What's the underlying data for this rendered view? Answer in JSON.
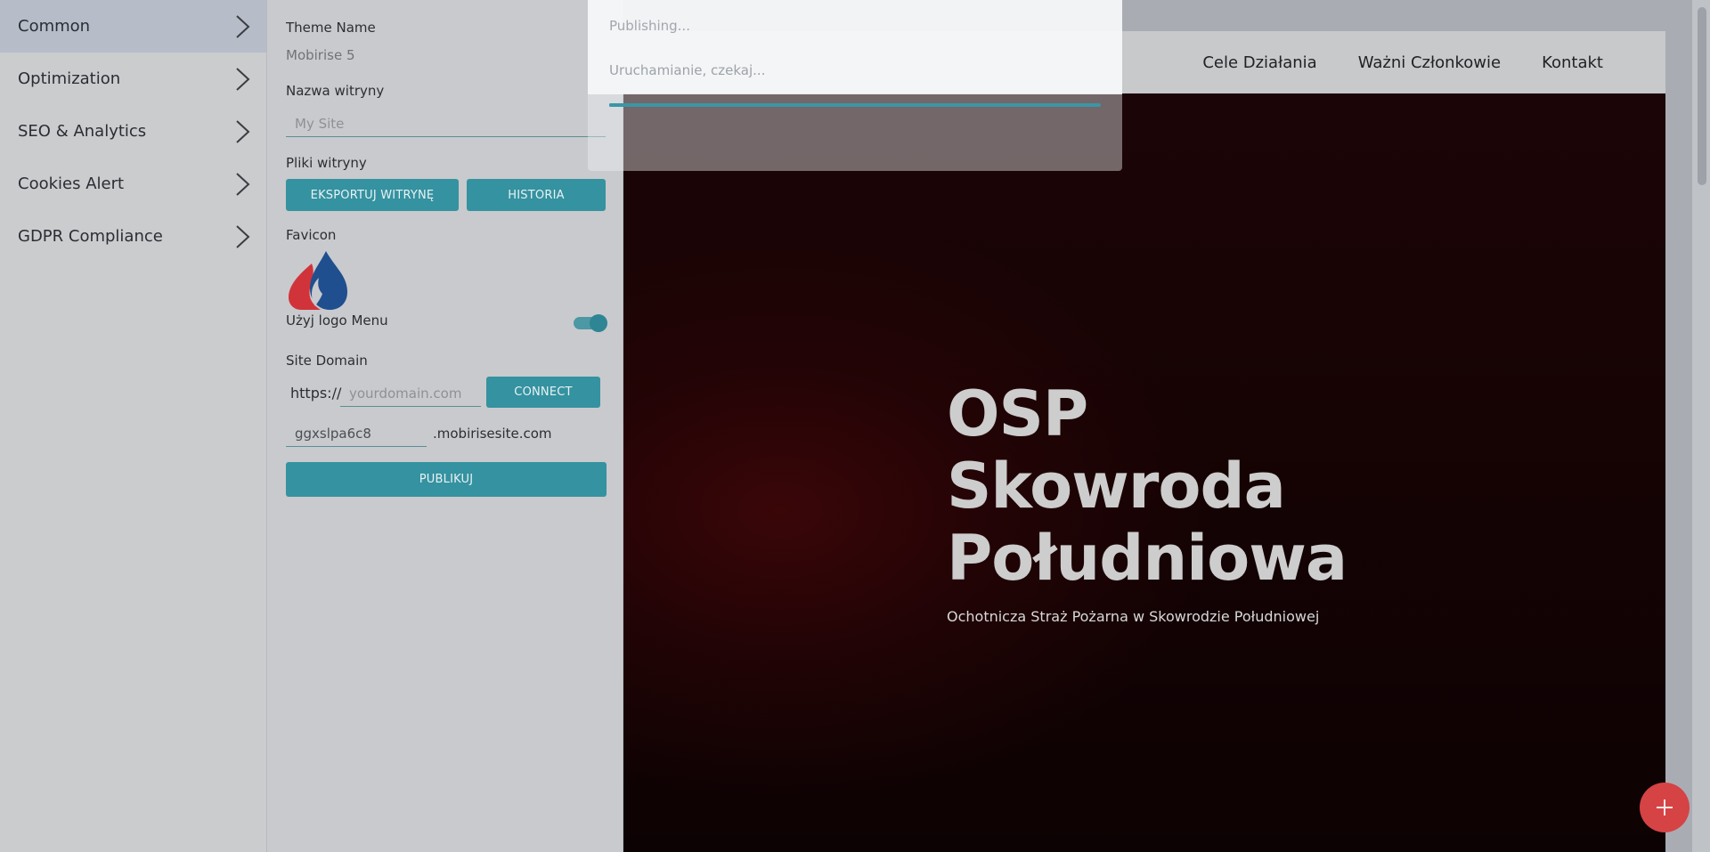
{
  "sidebar": {
    "items": [
      {
        "label": "Common"
      },
      {
        "label": "Optimization"
      },
      {
        "label": "SEO & Analytics"
      },
      {
        "label": "Cookies Alert"
      },
      {
        "label": "GDPR Compliance"
      }
    ]
  },
  "settings": {
    "theme_label": "Theme Name",
    "theme_value": "Mobirise 5",
    "site_name_label": "Nazwa witryny",
    "site_name_placeholder": "My Site",
    "files_label": "Pliki witryny",
    "export_button": "EKSPORTUJ WITRYNĘ",
    "history_button": "HISTORIA",
    "favicon_label": "Favicon",
    "use_logo_label": "Użyj logo Menu",
    "use_logo_on": true,
    "domain_label": "Site Domain",
    "https_prefix": "https://",
    "domain_placeholder": "yourdomain.com",
    "connect_button": "CONNECT",
    "subdomain_value": "ggxslpa6c8",
    "subdomain_suffix": ".mobirisesite.com",
    "publish_button": "PUBLIKUJ"
  },
  "site": {
    "nav": [
      "Cele Działania",
      "Ważni Członkowie",
      "Kontakt"
    ],
    "hero_title_lines": [
      "OSP",
      "Skowroda",
      "Południowa"
    ],
    "hero_subtitle": "Ochotnicza Straż Pożarna w Skowrodzie Południowej"
  },
  "publish_dialog": {
    "title": "Publishing...",
    "status": "Uruchamianie, czekaj...",
    "progress": 1.0
  },
  "colors": {
    "accent": "#3592a0",
    "fab": "#d64345",
    "favicon_red": "#d0343a",
    "favicon_blue": "#1f4f8f"
  }
}
